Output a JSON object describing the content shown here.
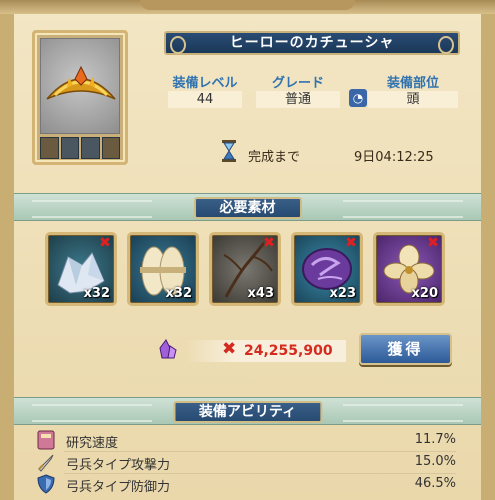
{
  "item": {
    "name": "ヒーローのカチューシャ",
    "stats": [
      {
        "label": "装備レベル",
        "value": "44"
      },
      {
        "label": "グレード",
        "value": "普通"
      },
      {
        "label": "装備部位",
        "value": "頭"
      }
    ],
    "timer_label": "完成まで",
    "timer_value": "9日04:12:25"
  },
  "materials_section": {
    "title": "必要素材",
    "items": [
      {
        "icon": "crystal-cluster-icon",
        "count": "x32",
        "missing": true
      },
      {
        "icon": "cotton-bundle-icon",
        "count": "x32",
        "missing": false
      },
      {
        "icon": "dry-branch-icon",
        "count": "x43",
        "missing": true
      },
      {
        "icon": "purple-pattern-icon",
        "count": "x23",
        "missing": true
      },
      {
        "icon": "orchid-flower-icon",
        "count": "x20",
        "missing": true
      }
    ],
    "missing_mark": "✖"
  },
  "cost": {
    "icon": "purple-crystal-icon",
    "mark": "✖",
    "value": "24,255,900",
    "button_label": "獲得"
  },
  "abilities_section": {
    "title": "装備アビリティ",
    "rows": [
      {
        "icon": "research-book-icon",
        "name": "研究速度",
        "value": "11.7%"
      },
      {
        "icon": "sword-icon",
        "name": "弓兵タイプ攻撃力",
        "value": "15.0%"
      },
      {
        "icon": "shield-icon",
        "name": "弓兵タイプ防御力",
        "value": "46.5%"
      }
    ]
  },
  "colors": {
    "accent_blue": "#264a70",
    "cost_red": "#d42a20",
    "section_green": "#a9c8b4"
  }
}
